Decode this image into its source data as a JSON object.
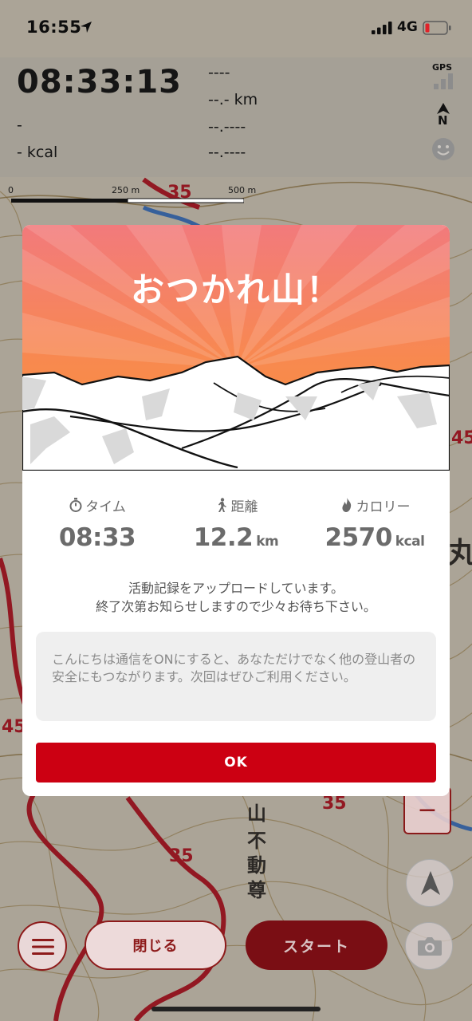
{
  "status_bar": {
    "time": "16:55",
    "network": "4G",
    "icons": [
      "location-arrow-icon",
      "signal-icon",
      "battery-icon"
    ]
  },
  "tracking": {
    "elapsed_time": "08:33:13",
    "pace": "-",
    "calories": "- kcal",
    "right_values": [
      "----",
      "--.- km",
      "--.----",
      "--.----"
    ],
    "gps_label": "GPS",
    "north_label": "N"
  },
  "map": {
    "scale_labels": [
      "0",
      "250 m",
      "500 m"
    ],
    "labels": {
      "place_name_chars": [
        "山",
        "不",
        "動",
        "尊"
      ],
      "contour_values": [
        "35",
        "35",
        "35",
        "45",
        "45"
      ],
      "partial_peak_label": "丸"
    }
  },
  "modal": {
    "title": "おつかれ山！",
    "stats": [
      {
        "label": "タイム",
        "icon": "stopwatch-icon",
        "value": "08:33",
        "unit": ""
      },
      {
        "label": "距離",
        "icon": "hiker-icon",
        "value": "12.2",
        "unit": "km"
      },
      {
        "label": "カロリー",
        "icon": "flame-icon",
        "value": "2570",
        "unit": "kcal"
      }
    ],
    "upload_message_line1": "活動記録をアップロードしています。",
    "upload_message_line2": "終了次第お知らせしますので少々お待ち下さい。",
    "tip_text": "こんにちは通信をONにすると、あなただけでなく他の登山者の安全にもつながります。次回はぜひご利用ください。",
    "ok_label": "OK"
  },
  "controls": {
    "zoom_out_label": "−",
    "close_label": "閉じる",
    "start_label": "スタート"
  },
  "colors": {
    "accent_red": "#cc0012",
    "dark_red": "#7a0e14",
    "hero_top": "#f27b7b",
    "hero_bottom": "#f78f3a"
  }
}
